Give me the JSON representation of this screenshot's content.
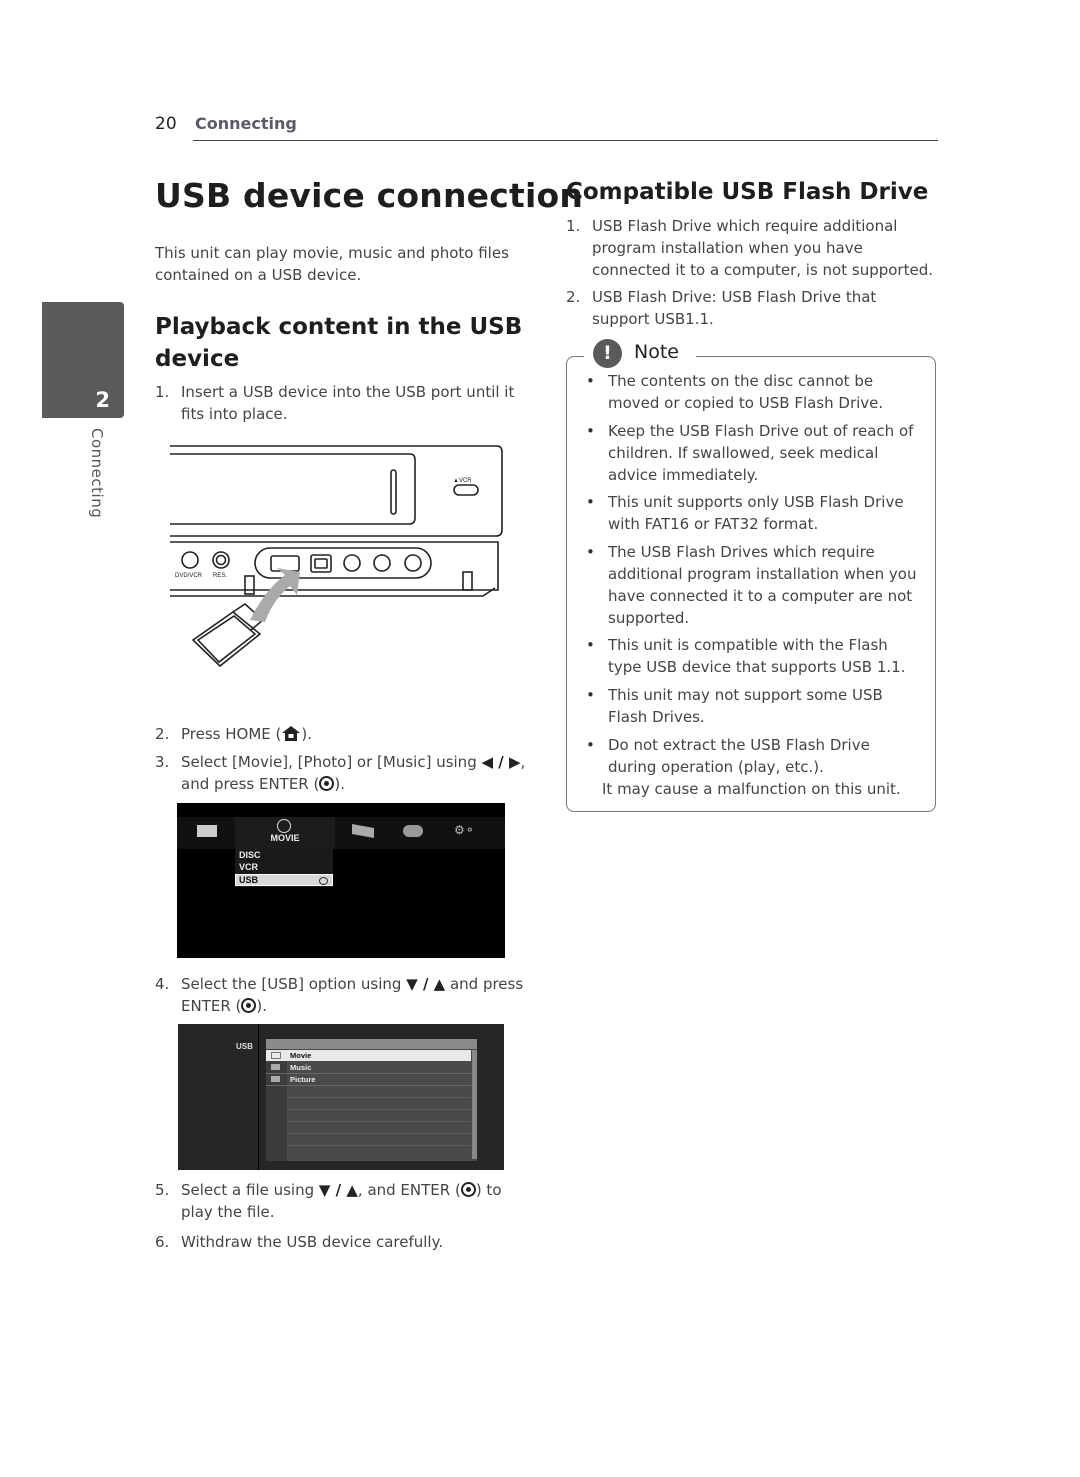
{
  "header": {
    "page_number": "20",
    "section": "Connecting"
  },
  "side_tab": {
    "chapter_number": "2",
    "chapter_label": "Connecting"
  },
  "left": {
    "title": "USB device connection",
    "intro": "This unit can play movie, music and photo files contained on a USB device.",
    "subtitle": "Playback content in the USB device",
    "steps": [
      {
        "num": "1.",
        "text": "Insert a USB device into the USB port until it fits into place."
      },
      {
        "num": "2.",
        "text_a": "Press HOME (",
        "icon": "home-icon",
        "text_b": ")."
      },
      {
        "num": "3.",
        "text_a": "Select [Movie], [Photo] or [Music] using ",
        "arrows": "◀ / ▶",
        "text_b": ", and press ENTER (",
        "icon": "enter-icon",
        "text_c": ")."
      },
      {
        "num": "4.",
        "text_a": "Select the [USB] option using ",
        "arrows": "▼ / ▲",
        "text_b": " and press ENTER (",
        "icon": "enter-icon",
        "text_c": ")."
      },
      {
        "num": "5.",
        "text_a": "Select a file using ",
        "arrows": "▼ / ▲",
        "text_b": ", and ENTER (",
        "icon": "enter-icon",
        "text_c": ") to play the file."
      },
      {
        "num": "6.",
        "text": "Withdraw the USB device carefully."
      }
    ],
    "device_illustration": {
      "labels": [
        "VCR",
        "DVD/VCR",
        "RES."
      ]
    },
    "home_menu_screen": {
      "tabs": [
        "tv-icon",
        "movie-icon",
        "photo-icon",
        "music-icon",
        "setup-icon"
      ],
      "active_tab_label": "MOVIE",
      "menu_items": [
        "DISC",
        "VCR",
        "USB"
      ],
      "selected_item": "USB"
    },
    "usb_browser_screen": {
      "device_label": "USB",
      "folders": [
        "Movie",
        "Music",
        "Picture"
      ],
      "selected_folder": "Movie"
    }
  },
  "right": {
    "title": "Compatible USB Flash Drive",
    "items": [
      {
        "num": "1.",
        "text": "USB Flash Drive which require additional program installation when you have connected it to a computer, is not supported."
      },
      {
        "num": "2.",
        "text": "USB Flash Drive: USB Flash Drive that support USB1.1."
      }
    ],
    "note": {
      "icon_label": "!",
      "title": "Note",
      "bullets": [
        "The contents on the disc cannot be moved or copied to USB Flash Drive.",
        "Keep the USB Flash Drive out of reach of children. If swallowed, seek medical advice immediately.",
        "This unit supports only USB Flash Drive with FAT16 or FAT32 format.",
        "The USB Flash Drives which require additional program installation when you have connected it to a computer are not supported.",
        "This unit is compatible with the Flash type USB device that supports USB 1.1.",
        "This unit may not support some USB Flash Drives.",
        "Do not extract the USB Flash Drive during operation (play, etc.)."
      ],
      "trailing_line": "It may cause a malfunction on this unit."
    }
  }
}
